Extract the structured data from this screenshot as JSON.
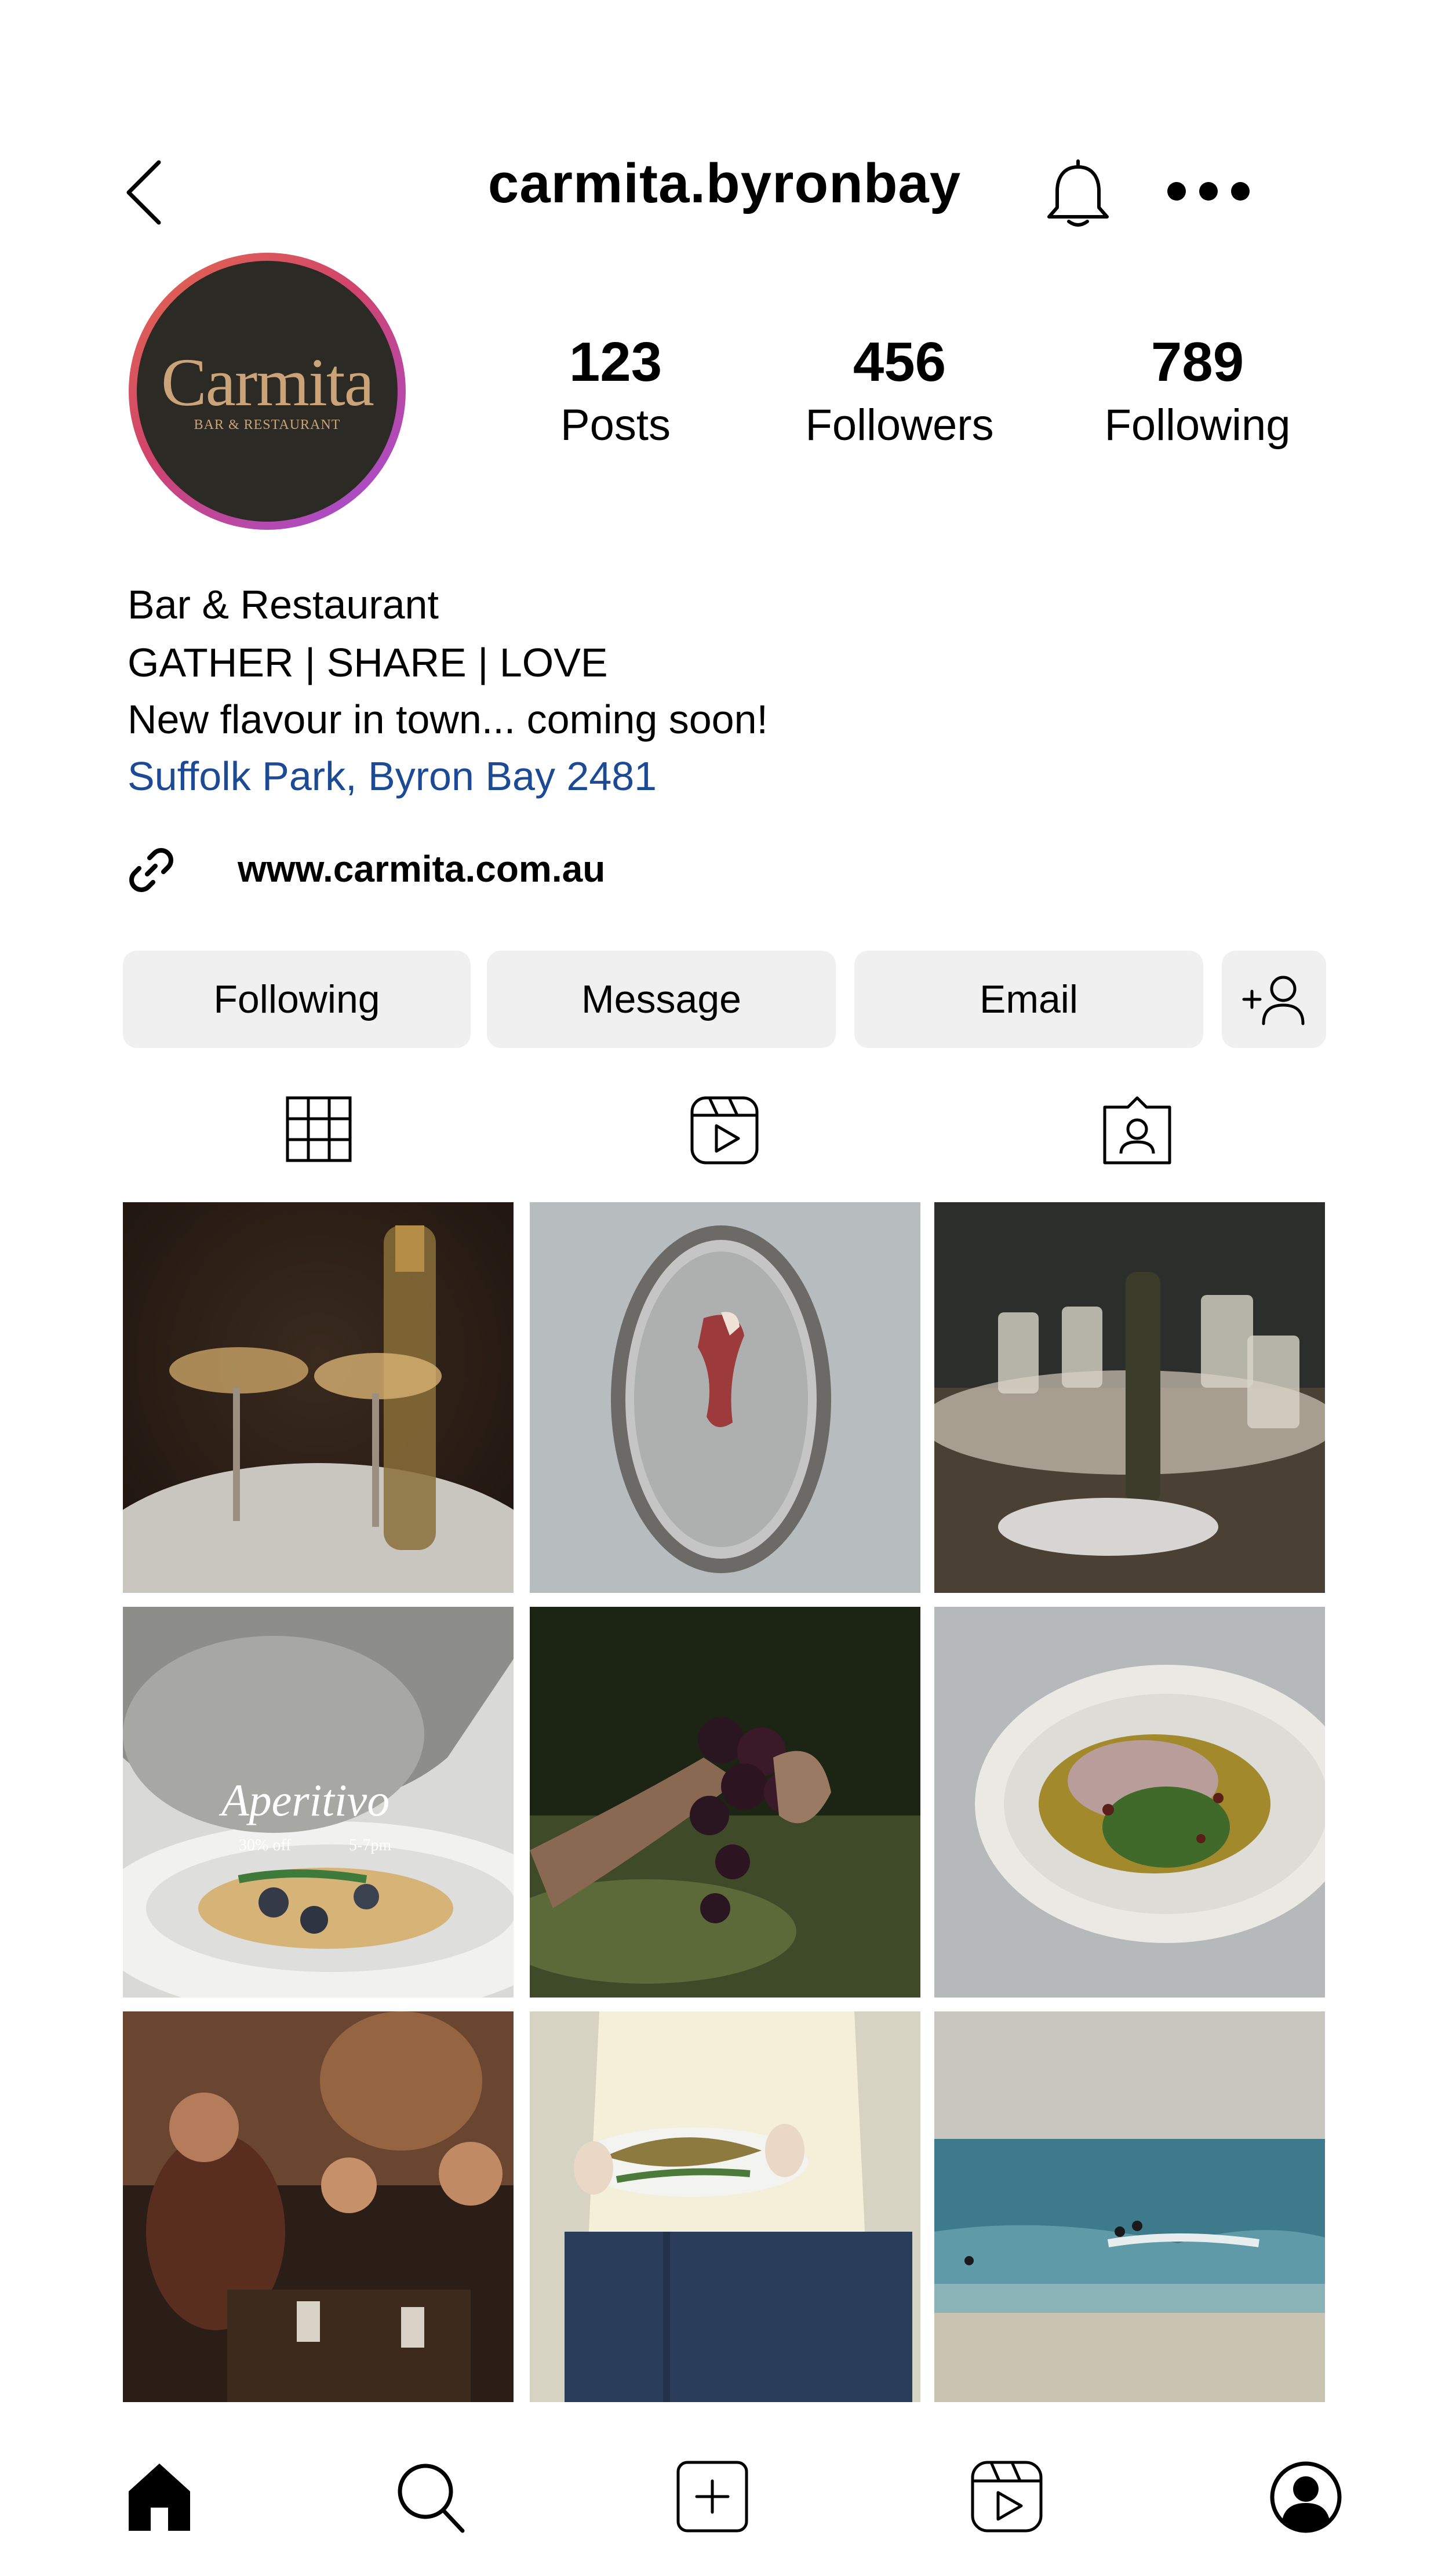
{
  "header": {
    "username": "carmita.byronbay",
    "back_icon": "chevron-left-icon",
    "notify_icon": "bell-icon",
    "more_icon": "more-horizontal-icon"
  },
  "profile": {
    "avatar_name": "Carmita",
    "avatar_subtitle": "BAR & RESTAURANT",
    "stats": [
      {
        "value": "123",
        "label": "Posts"
      },
      {
        "value": "456",
        "label": "Followers"
      },
      {
        "value": "789",
        "label": "Following"
      }
    ],
    "bio": {
      "line1": "Bar & Restaurant",
      "line2": "GATHER | SHARE | LOVE",
      "line3": "New flavour in town... coming soon!",
      "location": "Suffolk Park, Byron Bay 2481"
    },
    "website": "www.carmita.com.au",
    "accent_color": "#1c4a94"
  },
  "actions": {
    "following": "Following",
    "message": "Message",
    "email": "Email",
    "add_user_icon": "add-user-icon"
  },
  "tabs": [
    "grid-icon",
    "reels-icon",
    "tagged-icon"
  ],
  "posts": [
    {
      "overlay": ""
    },
    {
      "overlay": ""
    },
    {
      "overlay": ""
    },
    {
      "overlay": "Aperitivo",
      "sub_left": "30% off",
      "sub_right": "5-7pm"
    },
    {
      "overlay": ""
    },
    {
      "overlay": ""
    },
    {
      "overlay": ""
    },
    {
      "overlay": ""
    },
    {
      "overlay": ""
    }
  ],
  "bottom_nav": [
    "home-icon",
    "search-icon",
    "create-icon",
    "reels-icon",
    "profile-icon"
  ]
}
